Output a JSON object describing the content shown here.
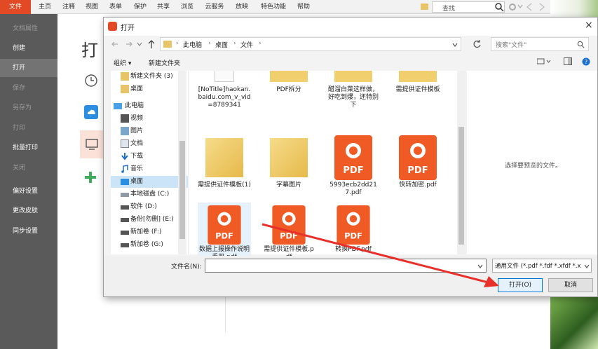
{
  "menubar": {
    "file": "文件",
    "items": [
      "主页",
      "注释",
      "视图",
      "表单",
      "保护",
      "共享",
      "浏览",
      "云服务",
      "放映",
      "特色功能",
      "帮助"
    ],
    "search_placeholder": "查找"
  },
  "sidebar": {
    "items": [
      {
        "label": "文档属性",
        "state": "dim"
      },
      {
        "label": "创建",
        "state": "normal"
      },
      {
        "label": "打开",
        "state": "active"
      },
      {
        "label": "保存",
        "state": "dim"
      },
      {
        "label": "另存为",
        "state": "dim"
      },
      {
        "label": "打印",
        "state": "dim"
      },
      {
        "label": "批量打印",
        "state": "normal"
      },
      {
        "label": "关闭",
        "state": "dim"
      },
      {
        "label": "偏好设置",
        "state": "normal"
      },
      {
        "label": "更改皮肤",
        "state": "normal"
      },
      {
        "label": "同步设置",
        "state": "normal"
      }
    ]
  },
  "main": {
    "title": "打"
  },
  "dialog": {
    "title": "打开",
    "close": "×",
    "address": [
      "此电脑",
      "桌面",
      "文件"
    ],
    "search_placeholder": "搜索\"文件\"",
    "toolbar": {
      "organize": "组织 ▾",
      "new_folder": "新建文件夹"
    },
    "nav_items": [
      {
        "label": "新建文件夹 (3)",
        "icon": "folder-icon",
        "indent": 1
      },
      {
        "label": "桌面",
        "icon": "folder-icon",
        "indent": 1
      },
      {
        "label": "此电脑",
        "icon": "computer-icon",
        "indent": 0
      },
      {
        "label": "视频",
        "icon": "video-icon",
        "indent": 1
      },
      {
        "label": "图片",
        "icon": "picture-icon",
        "indent": 1
      },
      {
        "label": "文档",
        "icon": "document-icon",
        "indent": 1
      },
      {
        "label": "下载",
        "icon": "download-icon",
        "indent": 1
      },
      {
        "label": "音乐",
        "icon": "music-icon",
        "indent": 1
      },
      {
        "label": "桌面",
        "icon": "desktop-icon",
        "indent": 1,
        "selected": true
      },
      {
        "label": "本地磁盘 (C:)",
        "icon": "drive-icon",
        "indent": 1
      },
      {
        "label": "软件 (D:)",
        "icon": "drive-icon",
        "indent": 1
      },
      {
        "label": "备份[勿删] (E:)",
        "icon": "drive-icon",
        "indent": 1
      },
      {
        "label": "新加卷 (F:)",
        "icon": "drive-icon",
        "indent": 1
      },
      {
        "label": "新加卷 (G:)",
        "icon": "drive-icon",
        "indent": 1
      }
    ],
    "files_row1": [
      {
        "label": "[NoTitle]haokan.baidu.com_v_vid=8789341",
        "type": "doc"
      },
      {
        "label": "PDF拆分",
        "type": "folder"
      },
      {
        "label": "醋溜白菜这样做，好吃到爆，还特别下",
        "type": "folder"
      },
      {
        "label": "需提供证件模板",
        "type": "folder"
      }
    ],
    "files_row2": [
      {
        "label": "需提供证件模板(1)",
        "type": "folder"
      },
      {
        "label": "字幕图片",
        "type": "folder"
      },
      {
        "label": "5993ecb2dd217.pdf",
        "type": "pdf"
      },
      {
        "label": "快转加密.pdf",
        "type": "pdf"
      }
    ],
    "files_row3": [
      {
        "label": "数据上报操作说明手册.pdf",
        "type": "pdf",
        "selected": true
      },
      {
        "label": "需提供证件模板.pdf",
        "type": "pdf"
      },
      {
        "label": "转换PDF.pdf",
        "type": "pdf"
      }
    ],
    "pdf_text": "PDF",
    "preview_text": "选择要预览的文件。",
    "filename_label": "文件名(N):",
    "filename_value": "",
    "filetype": "通用文件 (*.pdf *.fdf *.xfdf *.x",
    "open_button": "打开(O)",
    "cancel_button": "取消"
  },
  "colors": {
    "accent": "#e24a25",
    "pdf": "#f05a24",
    "sidebar": "#5a5a5a",
    "selection": "#cce4f7",
    "arrow": "#e8302a"
  }
}
